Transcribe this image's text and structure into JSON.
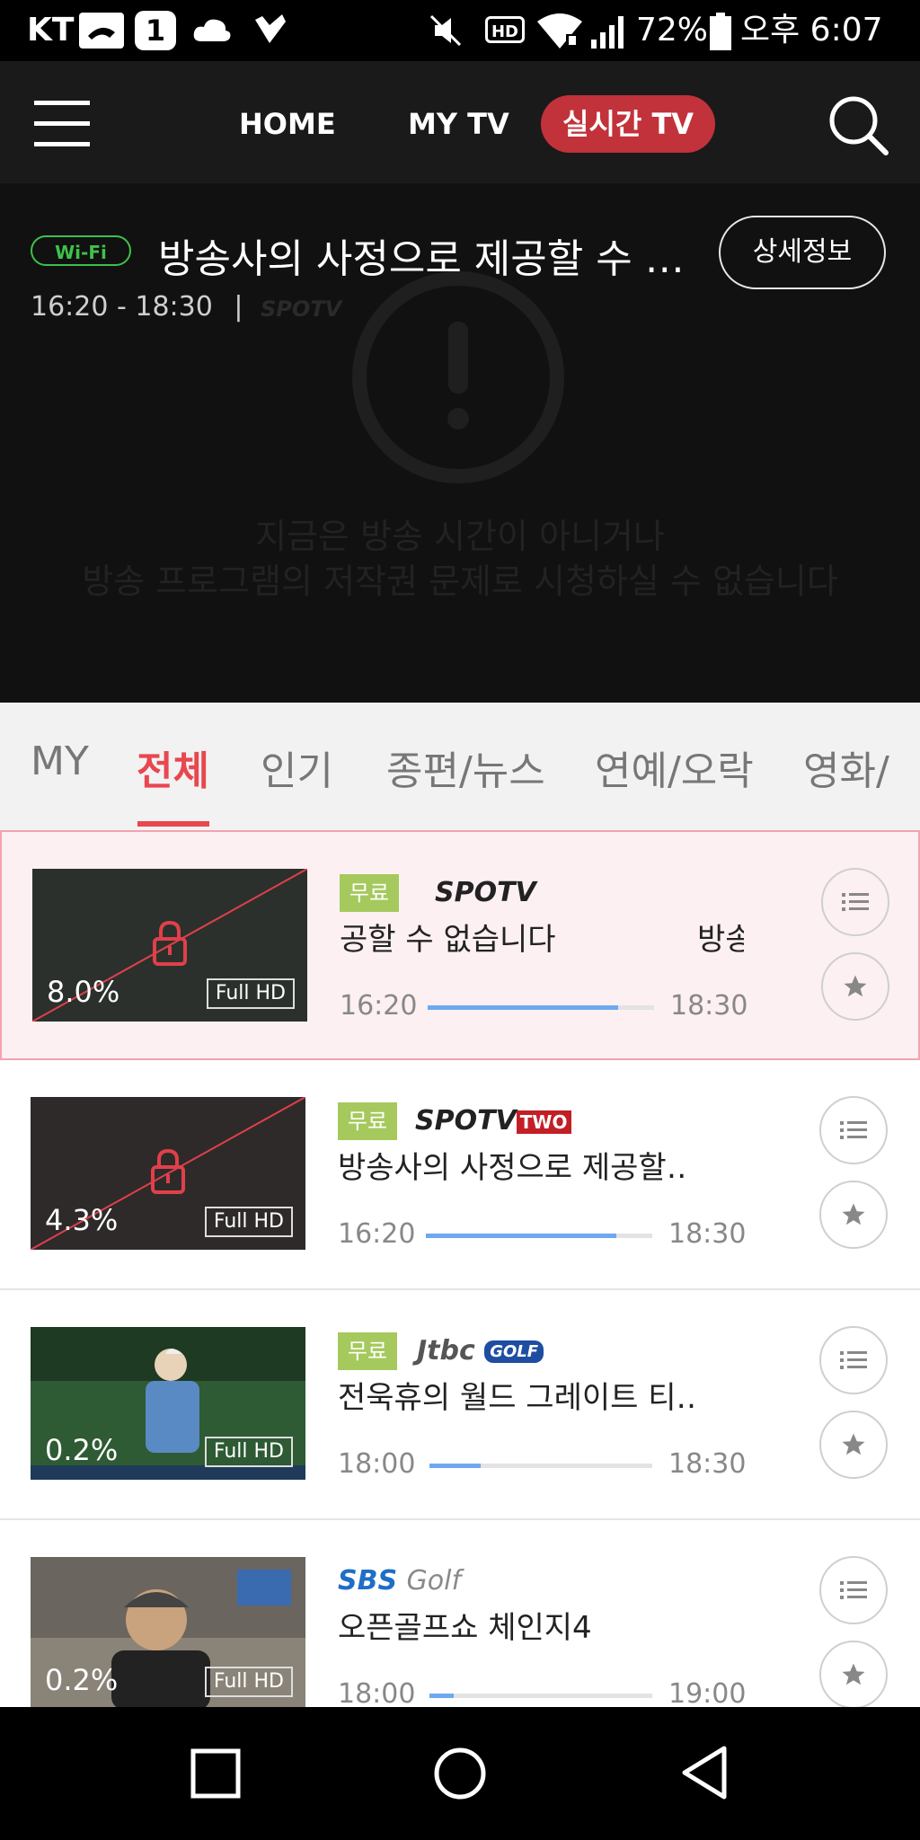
{
  "status_bar": {
    "carrier": "KT",
    "battery": "72%",
    "time": "오후 6:07",
    "icons": [
      "genie-icon",
      "one-icon",
      "cloud-icon",
      "check-icon",
      "mute-icon",
      "hd-icon",
      "wifi-icon",
      "signal-icon",
      "battery-icon"
    ],
    "hd_label": "HD",
    "one_label": "1"
  },
  "nav": {
    "home": "HOME",
    "my_tv": "MY TV",
    "live_tv": "실시간 TV",
    "active_color": "#c2323a"
  },
  "player": {
    "network_badge": "Wi-Fi",
    "title": "방송사의 사정으로 제공할 수 없습니다",
    "detail_button": "상세정보",
    "time_range": "16:20 - 18:30",
    "separator": "|",
    "channel_ghost": "SPOTV",
    "message_line1": "지금은 방송 시간이 아니거나",
    "message_line2": "방송 프로그램의 저작권 문제로 시청하실 수 없습니다"
  },
  "tabs": {
    "items": [
      "MY",
      "전체",
      "인기",
      "종편/뉴스",
      "연예/오락",
      "영화/"
    ],
    "active_index": 1,
    "accent": "#e8474f"
  },
  "channels": [
    {
      "rating": "8.0%",
      "quality": "Full HD",
      "badge": "무료",
      "channel": "SPOTV",
      "title": "공할 수 없습니다",
      "title_tail": "방송",
      "start": "16:20",
      "end": "18:30",
      "progress": 0.84,
      "locked": true,
      "selected": true
    },
    {
      "rating": "4.3%",
      "quality": "Full HD",
      "badge": "무료",
      "channel": "SPOTV",
      "channel_suffix": "TWO",
      "title": "방송사의 사정으로 제공할‥",
      "start": "16:20",
      "end": "18:30",
      "progress": 0.84,
      "locked": true,
      "selected": false
    },
    {
      "rating": "0.2%",
      "quality": "Full HD",
      "badge": "무료",
      "channel": "Jtbc",
      "channel_suffix": "GOLF",
      "title": "전욱휴의 월드 그레이트 티‥",
      "start": "18:00",
      "end": "18:30",
      "progress": 0.23,
      "locked": false,
      "selected": false
    },
    {
      "rating": "0.2%",
      "quality": "Full HD",
      "channel": "SBS",
      "channel_suffix": "Golf",
      "title": "오픈골프쇼 체인지4",
      "start": "18:00",
      "end": "19:00",
      "progress": 0.11,
      "locked": false,
      "selected": false
    }
  ]
}
